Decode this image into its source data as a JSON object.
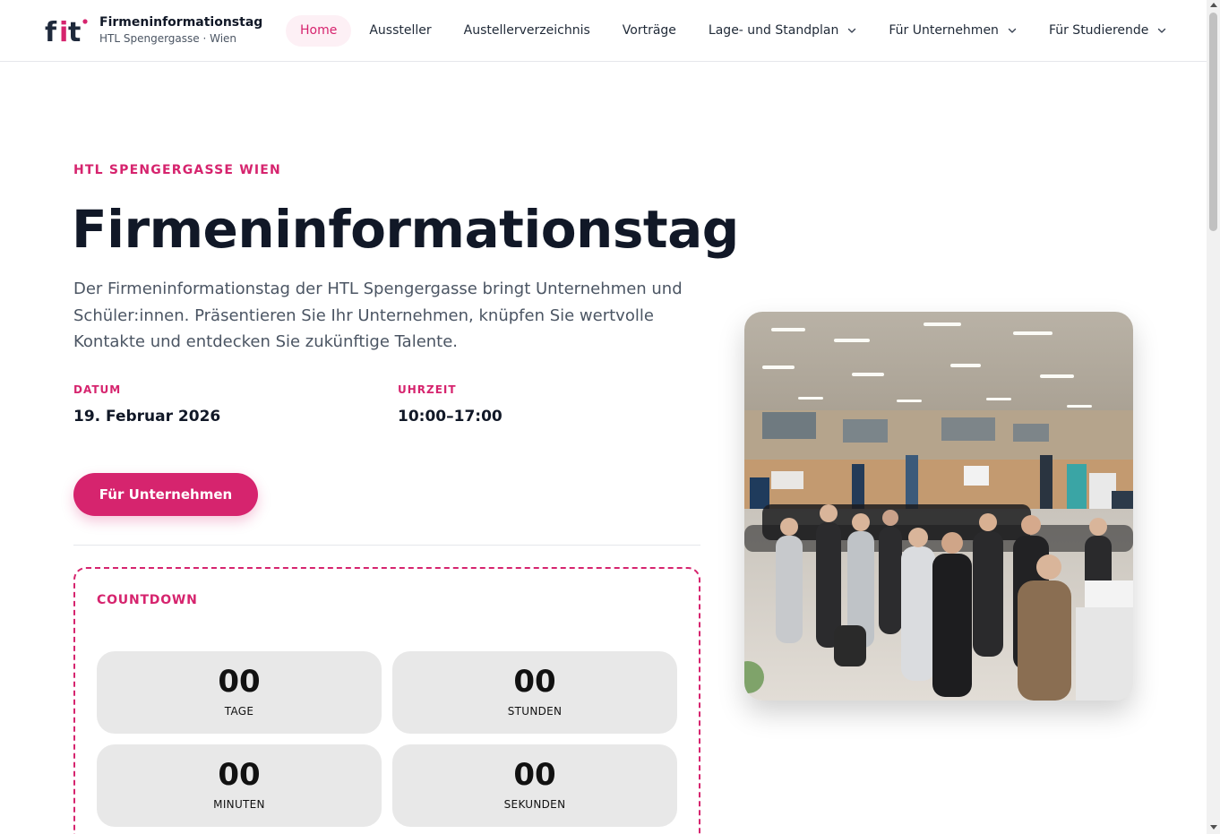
{
  "header": {
    "logo_text": "fit",
    "brand_title": "Firmeninformationstag",
    "brand_subtitle": "HTL Spengergasse · Wien",
    "nav": [
      {
        "label": "Home",
        "active": true,
        "dropdown": false
      },
      {
        "label": "Aussteller",
        "active": false,
        "dropdown": false
      },
      {
        "label": "Austellerverzeichnis",
        "active": false,
        "dropdown": false
      },
      {
        "label": "Vorträge",
        "active": false,
        "dropdown": false
      },
      {
        "label": "Lage- und Standplan",
        "active": false,
        "dropdown": true
      },
      {
        "label": "Für Unternehmen",
        "active": false,
        "dropdown": true
      },
      {
        "label": "Für Studierende",
        "active": false,
        "dropdown": true
      }
    ]
  },
  "hero": {
    "eyebrow": "HTL SPENGERGASSE WIEN",
    "title": "Firmeninformationstag",
    "description": "Der Firmeninformationstag der HTL Spengergasse bringt Unternehmen und Schüler:innen. Präsentieren Sie Ihr Unternehmen, knüpfen Sie wertvolle Kontakte und entdecken Sie zukünftige Talente.",
    "date_label": "DATUM",
    "date_value": "19. Februar 2026",
    "time_label": "UHRZEIT",
    "time_value": "10:00–17:00",
    "cta_label": "Für Unternehmen"
  },
  "countdown": {
    "label": "COUNTDOWN",
    "days": {
      "value": "00",
      "unit": "TAGE"
    },
    "hours": {
      "value": "00",
      "unit": "STUNDEN"
    },
    "minutes": {
      "value": "00",
      "unit": "MINUTEN"
    },
    "seconds": {
      "value": "00",
      "unit": "SEKUNDEN"
    }
  },
  "theme": {
    "accent": "#d6246e",
    "accent_soft": "#fdf0f5",
    "text_dark": "#111827",
    "text_muted": "#4b5563",
    "logo_dark": "#1e293b"
  },
  "icons": {
    "nav_dropdown": "chevron-down-icon"
  }
}
